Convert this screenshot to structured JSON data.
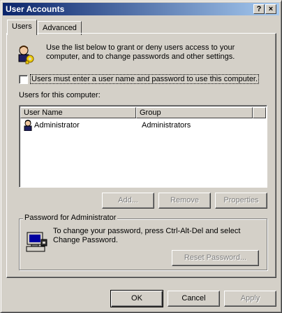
{
  "window": {
    "title": "User Accounts",
    "help_button": "?",
    "close_button": "×"
  },
  "tabs": [
    {
      "label": "Users",
      "active": true
    },
    {
      "label": "Advanced",
      "active": false
    }
  ],
  "intro": {
    "line1": "Use the list below to grant or deny users access to your",
    "line2": "computer, and to change passwords and other settings.",
    "icon": "users-keys-icon"
  },
  "must_login_checkbox": {
    "label": "Users must enter a user name and password to use this computer.",
    "checked": false
  },
  "users_label": "Users for this computer:",
  "users_table": {
    "columns": [
      "User Name",
      "Group"
    ],
    "rows": [
      {
        "user_name": "Administrator",
        "group": "Administrators",
        "icon": "user-icon"
      }
    ]
  },
  "list_buttons": {
    "add": "Add...",
    "remove": "Remove",
    "properties": "Properties"
  },
  "password_group": {
    "legend": "Password for Administrator",
    "line1": "To change your password, press Ctrl-Alt-Del and select",
    "line2": "Change Password.",
    "reset_button": "Reset Password...",
    "icon": "computer-icon"
  },
  "dialog_buttons": {
    "ok": "OK",
    "cancel": "Cancel",
    "apply": "Apply"
  }
}
